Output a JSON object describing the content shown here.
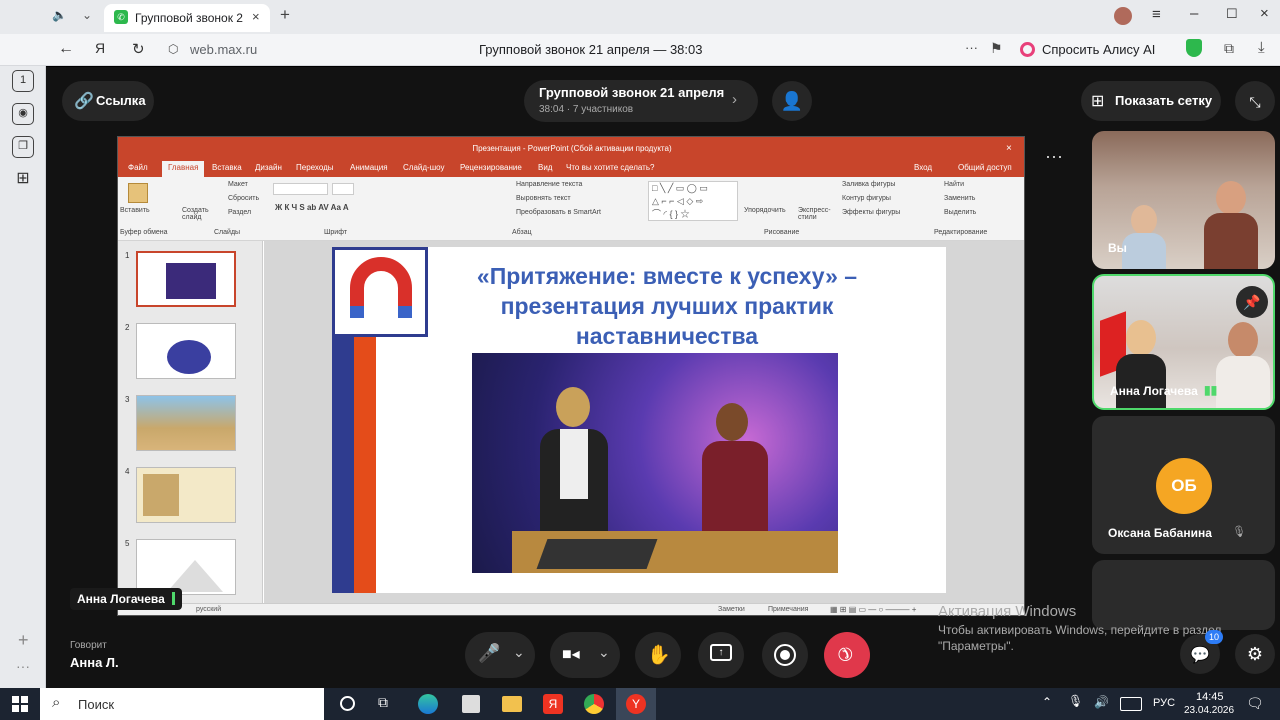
{
  "browser": {
    "tab_title": "Групповой звонок 2",
    "url": "web.max.ru",
    "page_title": "Групповой звонок 21 апреля — 38:03",
    "ask_alice": "Спросить Алису AI"
  },
  "call": {
    "link_label": "Ссылка",
    "title": "Групповой звонок 21 апреля",
    "subtitle": "38:04 · 7 участников",
    "show_grid": "Показать сетку",
    "presenter_label": "Анна Логачева",
    "speaking_label": "Говорит",
    "speaking_name": "Анна Л."
  },
  "participants": [
    {
      "name": "Вы"
    },
    {
      "name": "Анна Логачева"
    },
    {
      "name": "Оксана Бабанина",
      "initials": "ОБ",
      "color": "#f5a623"
    }
  ],
  "chat_badge": "10",
  "ppt": {
    "window_title": "Презентация - PowerPoint (Сбой активации продукта)",
    "menu": [
      "Файл",
      "Главная",
      "Вставка",
      "Дизайн",
      "Переходы",
      "Анимация",
      "Слайд-шоу",
      "Рецензирование",
      "Вид",
      "Что вы хотите сделать?"
    ],
    "login": "Вход",
    "share": "Общий доступ",
    "ribbon_groups": [
      "Буфер обмена",
      "Слайды",
      "Шрифт",
      "Абзац",
      "Рисование",
      "Редактирование"
    ],
    "ribbon_items": {
      "paste": "Вставить",
      "create": "Создать слайд",
      "layout": "Макет",
      "reset": "Сбросить",
      "section": "Раздел",
      "text_dir": "Направление текста",
      "align_text": "Выровнять текст",
      "smartart": "Преобразовать в SmartArt",
      "arrange": "Упорядочить",
      "styles": "Экспресс-стили",
      "fill": "Заливка фигуры",
      "outline": "Контур фигуры",
      "effects": "Эффекты фигуры",
      "find": "Найти",
      "replace": "Заменить",
      "select": "Выделить"
    },
    "thumb_numbers": [
      "1",
      "2",
      "3",
      "4",
      "5"
    ],
    "slide_title": "«Притяжение: вместе к успеху» – презентация лучших практик наставничества",
    "status_lang": "русский",
    "notes": "Заметки",
    "comments": "Примечания"
  },
  "watermark": {
    "line1": "Активация Windows",
    "line2": "Чтобы активировать Windows, перейдите в раздел",
    "line3": "\"Параметры\"."
  },
  "taskbar": {
    "search": "Поиск",
    "lang": "РУС",
    "time": "14:45",
    "date": "23.04.2026"
  },
  "colors": {
    "end_call": "#e0384b",
    "ppt_accent": "#c8452b",
    "active_speaker": "#4fd86b"
  }
}
